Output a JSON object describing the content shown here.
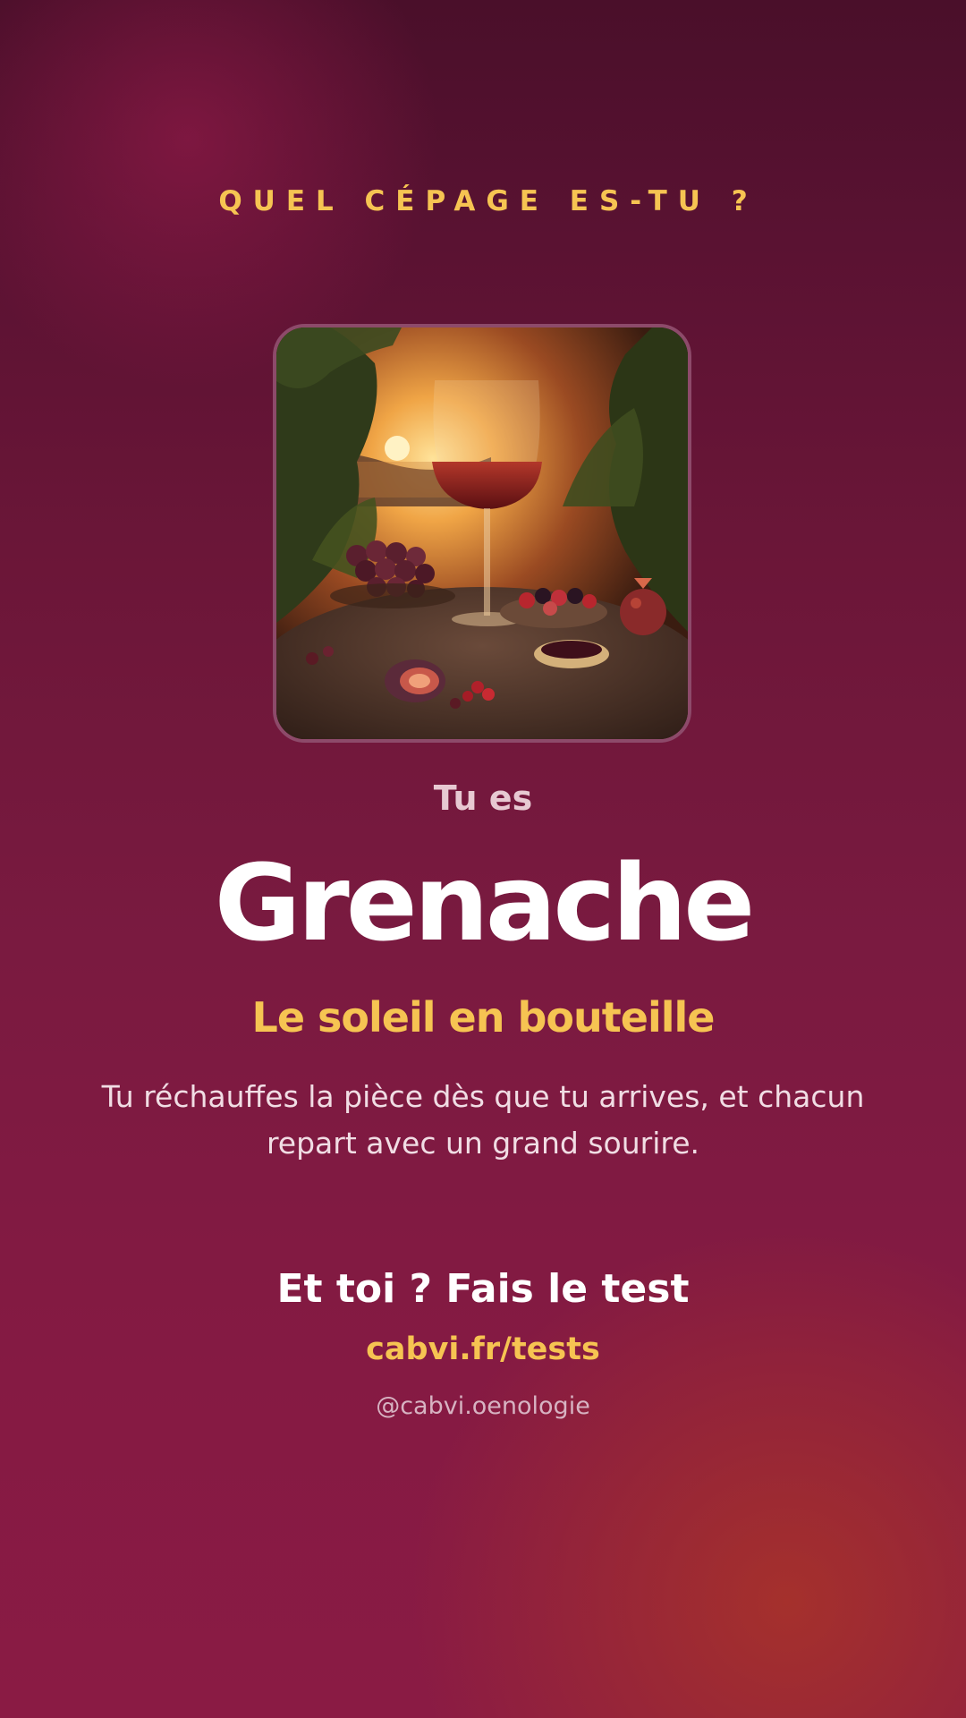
{
  "header": {
    "kicker": "QUEL CÉPAGE ES-TU ?"
  },
  "result": {
    "image_alt": "Verre de vin rouge au coucher du soleil avec raisins, figues et fruits rouges",
    "intro": "Tu es",
    "name": "Grenache",
    "tagline": "Le soleil en bouteille",
    "description": "Tu réchauffes la pièce dès que tu arrives, et chacun repart avec un grand sourire."
  },
  "footer": {
    "cta": "Et toi ? Fais le test",
    "url": "cabvi.fr/tests",
    "handle": "@cabvi.oenologie"
  },
  "colors": {
    "accent": "#f6c452",
    "background_top": "#4a0f2a",
    "background_bottom": "#8a1b44",
    "text_primary": "#ffffff"
  }
}
